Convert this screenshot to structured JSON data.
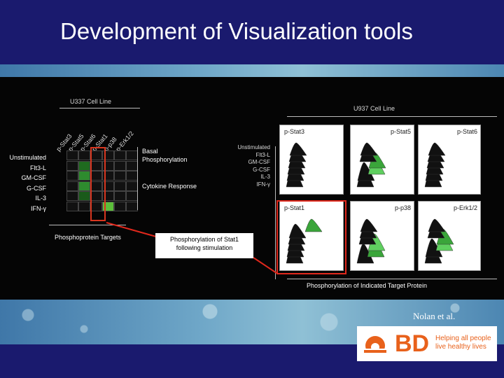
{
  "slide": {
    "title": "Development of Visualization tools",
    "citation": "Nolan et al."
  },
  "left_figure": {
    "header": "U337 Cell Line",
    "columns": [
      "p-Stat3",
      "p-Stat5",
      "p-Stat6",
      "p-Stat1",
      "p-p38",
      "p-Erk1/2"
    ],
    "rows": [
      "Unstimulated",
      "Flt3-L",
      "GM-CSF",
      "G-CSF",
      "IL-3",
      "IFN-γ"
    ],
    "basal_label": "Basal Phosphorylation",
    "cytokine_label": "Cytokine Response",
    "x_caption": "Phosphoprotein Targets",
    "cell_colors": [
      [
        "#111",
        "#111",
        "#111",
        "#111",
        "#111",
        "#111"
      ],
      [
        "#111",
        "#1f6b1f",
        "#111",
        "#111",
        "#111",
        "#111"
      ],
      [
        "#111",
        "#2e8b2e",
        "#111",
        "#111",
        "#111",
        "#111"
      ],
      [
        "#111",
        "#2e8b2e",
        "#111",
        "#111",
        "#111",
        "#111"
      ],
      [
        "#111",
        "#1a5a1a",
        "#111",
        "#111",
        "#111",
        "#111"
      ],
      [
        "#111",
        "#111",
        "#111",
        "#5cbf3a",
        "#111",
        "#111"
      ]
    ]
  },
  "callout": {
    "text_line1": "Phosphorylation of Stat1",
    "text_line2": "following stimulation"
  },
  "right_figure": {
    "header": "U937 Cell Line",
    "row_labels": [
      "Unstimulated",
      "Flt3-L",
      "GM-CSF",
      "G-CSF",
      "IL-3",
      "IFN-γ"
    ],
    "panels": [
      {
        "name": "p-Stat3"
      },
      {
        "name": "p-Stat5"
      },
      {
        "name": "p-Stat6"
      },
      {
        "name": "p-Stat1"
      },
      {
        "name": "p-p38"
      },
      {
        "name": "p-Erk1/2"
      }
    ],
    "x_caption": "Phosphorylation of Indicated Target Protein"
  },
  "logo": {
    "brand": "BD",
    "tagline_1": "Helping all people",
    "tagline_2": "live healthy lives",
    "brand_color": "#e8611b"
  }
}
